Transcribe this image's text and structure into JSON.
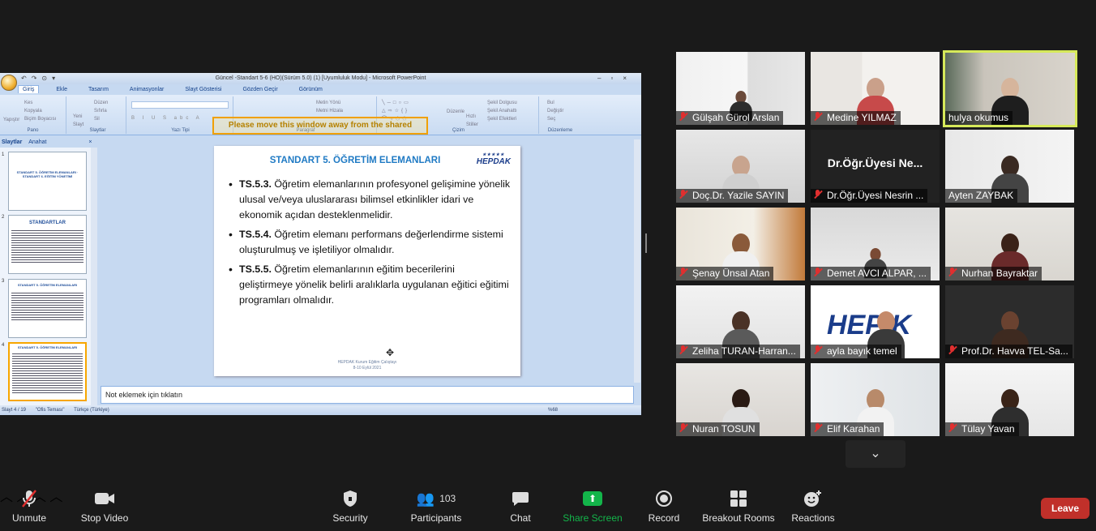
{
  "powerpoint": {
    "window_title": "Güncel -Standart 5-6 (HO)(Sürüm 5.0) (1) [Uyumluluk Modu] - Microsoft PowerPoint",
    "ribbon_tabs": [
      "Giriş",
      "Ekle",
      "Tasarım",
      "Animasyonlar",
      "Slayt Gösterisi",
      "Gözden Geçir",
      "Görünüm"
    ],
    "ribbon_groups": [
      "Pano",
      "Slaytlar",
      "Yazı Tipi",
      "Paragraf",
      "Çizim",
      "Düzenleme"
    ],
    "clipboard_items": [
      "Kes",
      "Kopyala",
      "Biçim Boyacısı"
    ],
    "paste_label": "Yapıştır",
    "slides_items": [
      "Düzen",
      "Sıfırla",
      "Sil"
    ],
    "new_slide_label": "Yeni Slayt",
    "paragraph_items": [
      "Metin Yönü",
      "Metni Hizala"
    ],
    "drawing_items": [
      "Şekil Dolgusu",
      "Şekil Anahattı",
      "Şekil Efektleri"
    ],
    "arrange_label": "Düzenle",
    "quick_styles_label": "Hızlı Stiller",
    "editing_items": [
      "Bul",
      "Değiştir",
      "Seç"
    ],
    "share_warning": "Please move this window away from the shared",
    "pane_tabs": [
      "Slaytlar",
      "Anahat"
    ],
    "thumbs": [
      {
        "num": "1",
        "title": "STANDART 5. ÖĞRETİM ELEMANLARI · STANDART 6. EĞİTİM YÖNETİMİ"
      },
      {
        "num": "2",
        "title": "STANDARTLAR"
      },
      {
        "num": "3",
        "title": "STANDART 5. ÖĞRETİM ELEMANLARI"
      },
      {
        "num": "4",
        "title": "STANDART 5. ÖĞRETİM ELEMANLARI"
      }
    ],
    "slide": {
      "title": "STANDART 5. ÖĞRETİM ELEMANLARI",
      "logo": "HEPDAK",
      "bullets": [
        {
          "code": "TS.5.3.",
          "text": " Öğretim elemanlarının profesyonel gelişimine yönelik ulusal ve/veya uluslararası bilimsel etkinlikler idari ve ekonomik açıdan desteklenmelidir."
        },
        {
          "code": "TS.5.4.",
          "text": " Öğretim elemanı performans değerlendirme sistemi oluşturulmuş ve işletiliyor olmalıdır."
        },
        {
          "code": "TS.5.5.",
          "text": " Öğretim elemanlarının eğitim becerilerini geliştirmeye yönelik belirli aralıklarla uygulanan eğitici eğitimi programları olmalıdır."
        }
      ],
      "footer_line1": "HEPDAK Kurum Eğitim Çalıştayı",
      "footer_line2": "8-10 Eylül 2021"
    },
    "notes_placeholder": "Not eklemek için tıklatın",
    "status": {
      "slide": "Slayt 4 / 19",
      "theme": "\"Ofis Teması\"",
      "language": "Türkçe (Türkiye)",
      "zoom": "%68"
    }
  },
  "participants_gallery": [
    {
      "name": "Gülşah Gürol Arslan",
      "muted": true
    },
    {
      "name": "Medine YILMAZ",
      "muted": true
    },
    {
      "name": "hulya okumus",
      "muted": false,
      "active_speaker": true
    },
    {
      "name": "Doç.Dr. Yazile SAYIN",
      "muted": true
    },
    {
      "name": "Dr.Öğr.Üyesi Nesrin ...",
      "muted": true,
      "video_off_label": "Dr.Öğr.Üyesi  Ne..."
    },
    {
      "name": "Ayten ZAYBAK",
      "muted": false
    },
    {
      "name": "Şenay Ünsal Atan",
      "muted": true
    },
    {
      "name": "Demet AVCI ALPAR, ...",
      "muted": true
    },
    {
      "name": "Nurhan Bayraktar",
      "muted": true
    },
    {
      "name": "Zeliha TURAN-Harran...",
      "muted": true
    },
    {
      "name": "ayla bayık temel",
      "muted": true
    },
    {
      "name": "Prof.Dr. Havva TEL-Sa...",
      "muted": true
    },
    {
      "name": "Nuran TOSUN",
      "muted": true
    },
    {
      "name": "Elif Karahan",
      "muted": true
    },
    {
      "name": "Tülay Yavan",
      "muted": true
    }
  ],
  "meeting_toolbar": {
    "unmute": "Unmute",
    "stop_video": "Stop Video",
    "security": "Security",
    "participants": "Participants",
    "participants_count": "103",
    "chat": "Chat",
    "share_screen": "Share Screen",
    "record": "Record",
    "breakout_rooms": "Breakout Rooms",
    "reactions": "Reactions",
    "leave": "Leave"
  },
  "colors": {
    "active_speaker_border": "#d6e95a",
    "share_green": "#13b54a",
    "leave_red": "#c0302a",
    "slide_title_blue": "#1f7ac4"
  }
}
